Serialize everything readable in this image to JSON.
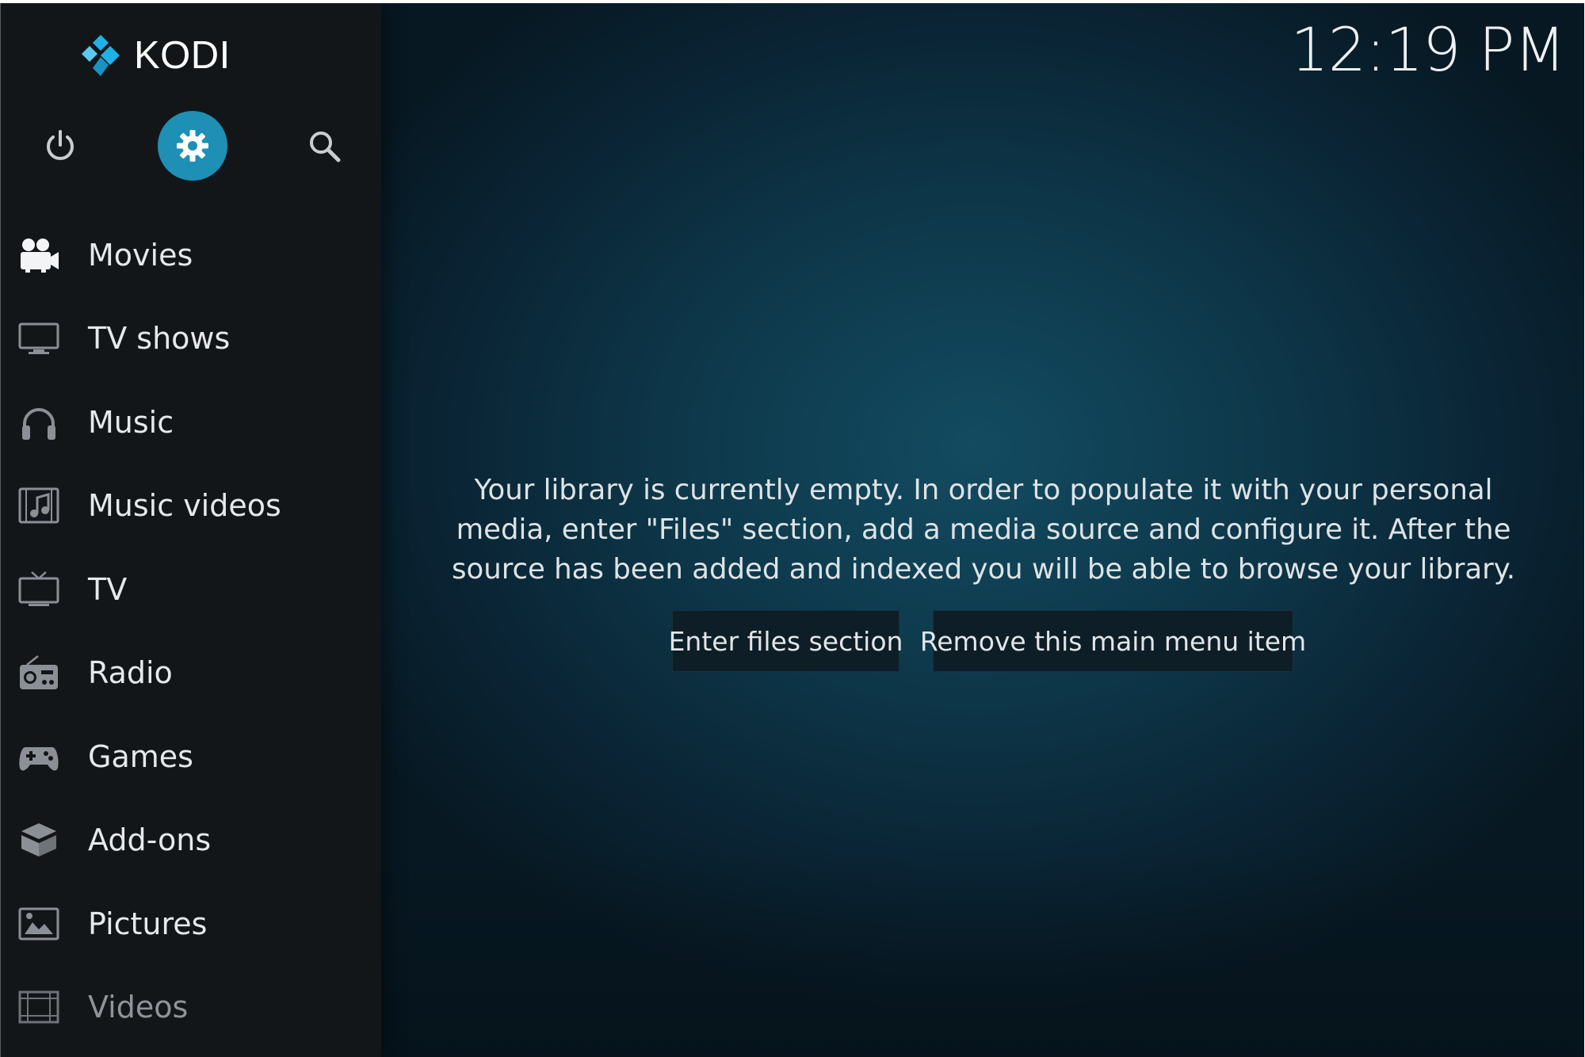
{
  "app": {
    "name": "KODI",
    "clock": "12:19 PM"
  },
  "top_controls": [
    {
      "id": "power",
      "icon": "power-icon"
    },
    {
      "id": "settings",
      "icon": "gear-icon",
      "active": true,
      "color": "#1e8fb5"
    },
    {
      "id": "search",
      "icon": "search-icon"
    }
  ],
  "sidebar": {
    "items": [
      {
        "label": "Movies",
        "icon": "movie-camera-icon"
      },
      {
        "label": "TV shows",
        "icon": "monitor-icon"
      },
      {
        "label": "Music",
        "icon": "headphones-icon"
      },
      {
        "label": "Music videos",
        "icon": "music-video-icon"
      },
      {
        "label": "TV",
        "icon": "tv-icon"
      },
      {
        "label": "Radio",
        "icon": "radio-icon"
      },
      {
        "label": "Games",
        "icon": "gamepad-icon"
      },
      {
        "label": "Add-ons",
        "icon": "addons-box-icon"
      },
      {
        "label": "Pictures",
        "icon": "picture-icon"
      },
      {
        "label": "Videos",
        "icon": "film-strip-icon"
      }
    ]
  },
  "main": {
    "message": "Your library is currently empty. In order to populate it with your personal media, enter \"Files\" section, add a media source and configure it. After the source has been added and indexed you will be able to browse your library.",
    "buttons": {
      "enter_files": "Enter files section",
      "remove_item": "Remove this main menu item"
    }
  },
  "colors": {
    "accent": "#1e8fb5",
    "sidebar_bg": "#131619",
    "background": "#0d3648"
  }
}
